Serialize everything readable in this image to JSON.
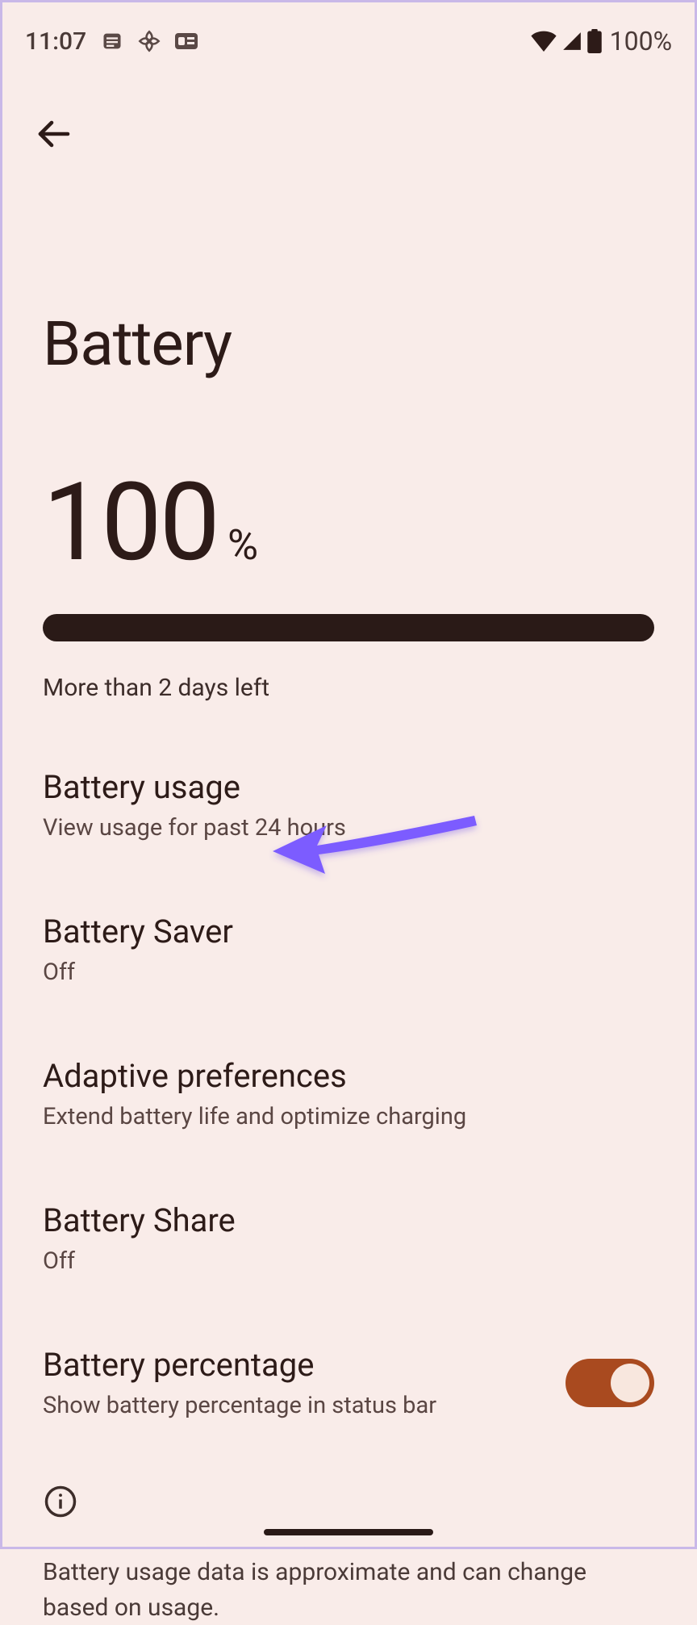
{
  "status_bar": {
    "time": "11:07",
    "battery_text": "100%"
  },
  "app_bar": {},
  "page": {
    "title": "Battery"
  },
  "battery_level": {
    "value": "100",
    "percent_symbol": "%",
    "estimate": "More than 2 days left"
  },
  "items": {
    "usage": {
      "title": "Battery usage",
      "sub": "View usage for past 24 hours"
    },
    "saver": {
      "title": "Battery Saver",
      "sub": "Off"
    },
    "adaptive": {
      "title": "Adaptive preferences",
      "sub": "Extend battery life and optimize charging"
    },
    "share": {
      "title": "Battery Share",
      "sub": "Off"
    },
    "percentage": {
      "title": "Battery percentage",
      "sub": "Show battery percentage in status bar",
      "toggle": true
    }
  },
  "footer": {
    "info_text": "Battery usage data is approximate and can change based on usage."
  }
}
